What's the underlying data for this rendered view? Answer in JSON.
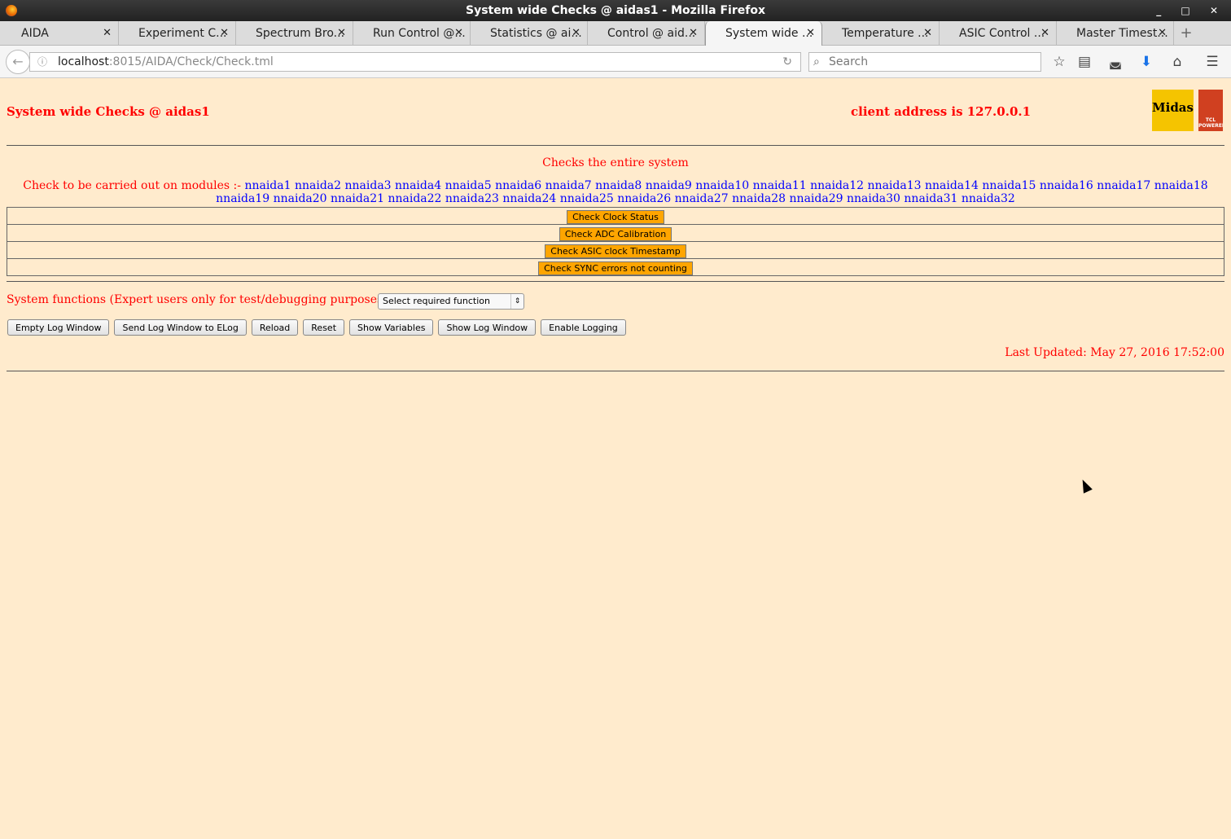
{
  "window": {
    "title": "System wide Checks @ aidas1 - Mozilla Firefox",
    "controls": "_ □ ✕"
  },
  "tabs": [
    {
      "label": "AIDA"
    },
    {
      "label": "Experiment C..."
    },
    {
      "label": "Spectrum Bro..."
    },
    {
      "label": "Run Control @..."
    },
    {
      "label": "Statistics @ ai..."
    },
    {
      "label": "Control @ aid..."
    },
    {
      "label": "System wide ..."
    },
    {
      "label": "Temperature ..."
    },
    {
      "label": "ASIC Control ..."
    },
    {
      "label": "Master Timest..."
    }
  ],
  "navbar": {
    "url_host": "localhost",
    "url_path": ":8015/AIDA/Check/Check.tml",
    "search_placeholder": "Search"
  },
  "header": {
    "title": "System wide Checks @ aidas1",
    "client": "client address is 127.0.0.1",
    "logo_text": "Midas",
    "logo2_text": "TCL POWERED"
  },
  "checks": {
    "description": "Checks the entire system",
    "modules_label": "Check to be carried out on modules :-",
    "modules": [
      "nnaida1",
      "nnaida2",
      "nnaida3",
      "nnaida4",
      "nnaida5",
      "nnaida6",
      "nnaida7",
      "nnaida8",
      "nnaida9",
      "nnaida10",
      "nnaida11",
      "nnaida12",
      "nnaida13",
      "nnaida14",
      "nnaida15",
      "nnaida16",
      "nnaida17",
      "nnaida18",
      "nnaida19",
      "nnaida20",
      "nnaida21",
      "nnaida22",
      "nnaida23",
      "nnaida24",
      "nnaida25",
      "nnaida26",
      "nnaida27",
      "nnaida28",
      "nnaida29",
      "nnaida30",
      "nnaida31",
      "nnaida32"
    ],
    "buttons": [
      "Check Clock Status",
      "Check ADC Calibration",
      "Check ASIC clock Timestamp",
      "Check SYNC errors not counting"
    ]
  },
  "system": {
    "label": "System functions (Expert users only for test/debugging purposes!!!)",
    "select_value": "Select required function",
    "buttons": [
      "Empty Log Window",
      "Send Log Window to ELog",
      "Reload",
      "Reset",
      "Show Variables",
      "Show Log Window",
      "Enable Logging"
    ]
  },
  "footer": {
    "updated": "Last Updated: May 27, 2016 17:52:00"
  }
}
